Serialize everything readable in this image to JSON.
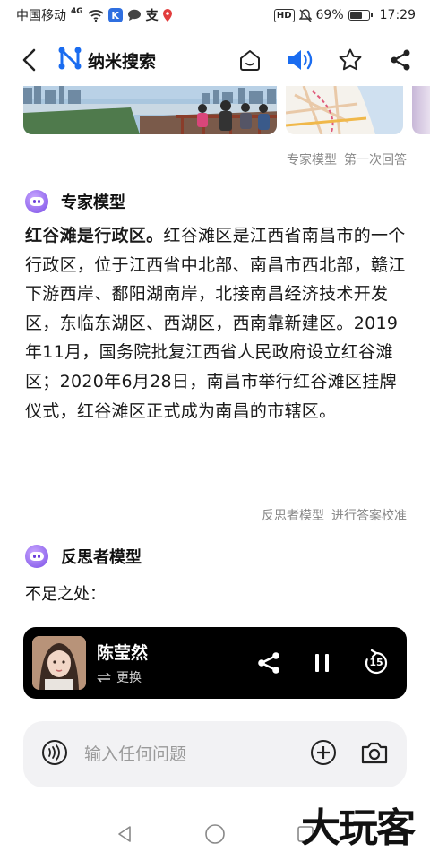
{
  "status_bar": {
    "carrier": "中国移动",
    "network": "4G",
    "battery": "69%",
    "battery_level": 0.69,
    "time": "17:29",
    "hd_label": "HD",
    "app_badge": "K",
    "zhi_label": "支"
  },
  "header": {
    "title": "纳米搜索",
    "icons": [
      "back-icon",
      "nami-logo-icon",
      "home-icon",
      "speaker-icon",
      "star-icon",
      "share-icon"
    ],
    "accent_color": "#1a6cf0"
  },
  "expert": {
    "meta_model": "专家模型",
    "meta_round": "第一次回答",
    "title": "专家模型",
    "answer_bold": "红谷滩是行政区。",
    "answer_rest": "红谷滩区是江西省南昌市的一个行政区，位于江西省中北部、南昌市西北部，赣江下游西岸、鄱阳湖南岸，北接南昌经济技术开发区，东临东湖区、西湖区，西南靠新建区。2019年11月，国务院批复江西省人民政府设立红谷滩区；2020年6月28日，南昌市举行红谷滩区挂牌仪式，红谷滩区正式成为南昌的市辖区。"
  },
  "reflector": {
    "meta_model": "反思者模型",
    "meta_action": "进行答案校准",
    "title": "反思者模型",
    "subtext": "不足之处："
  },
  "player": {
    "voice_name": "陈莹然",
    "switch_label": "更换",
    "replay_seconds": "15"
  },
  "input": {
    "placeholder": "输入任何问题"
  },
  "watermark": "大玩客"
}
